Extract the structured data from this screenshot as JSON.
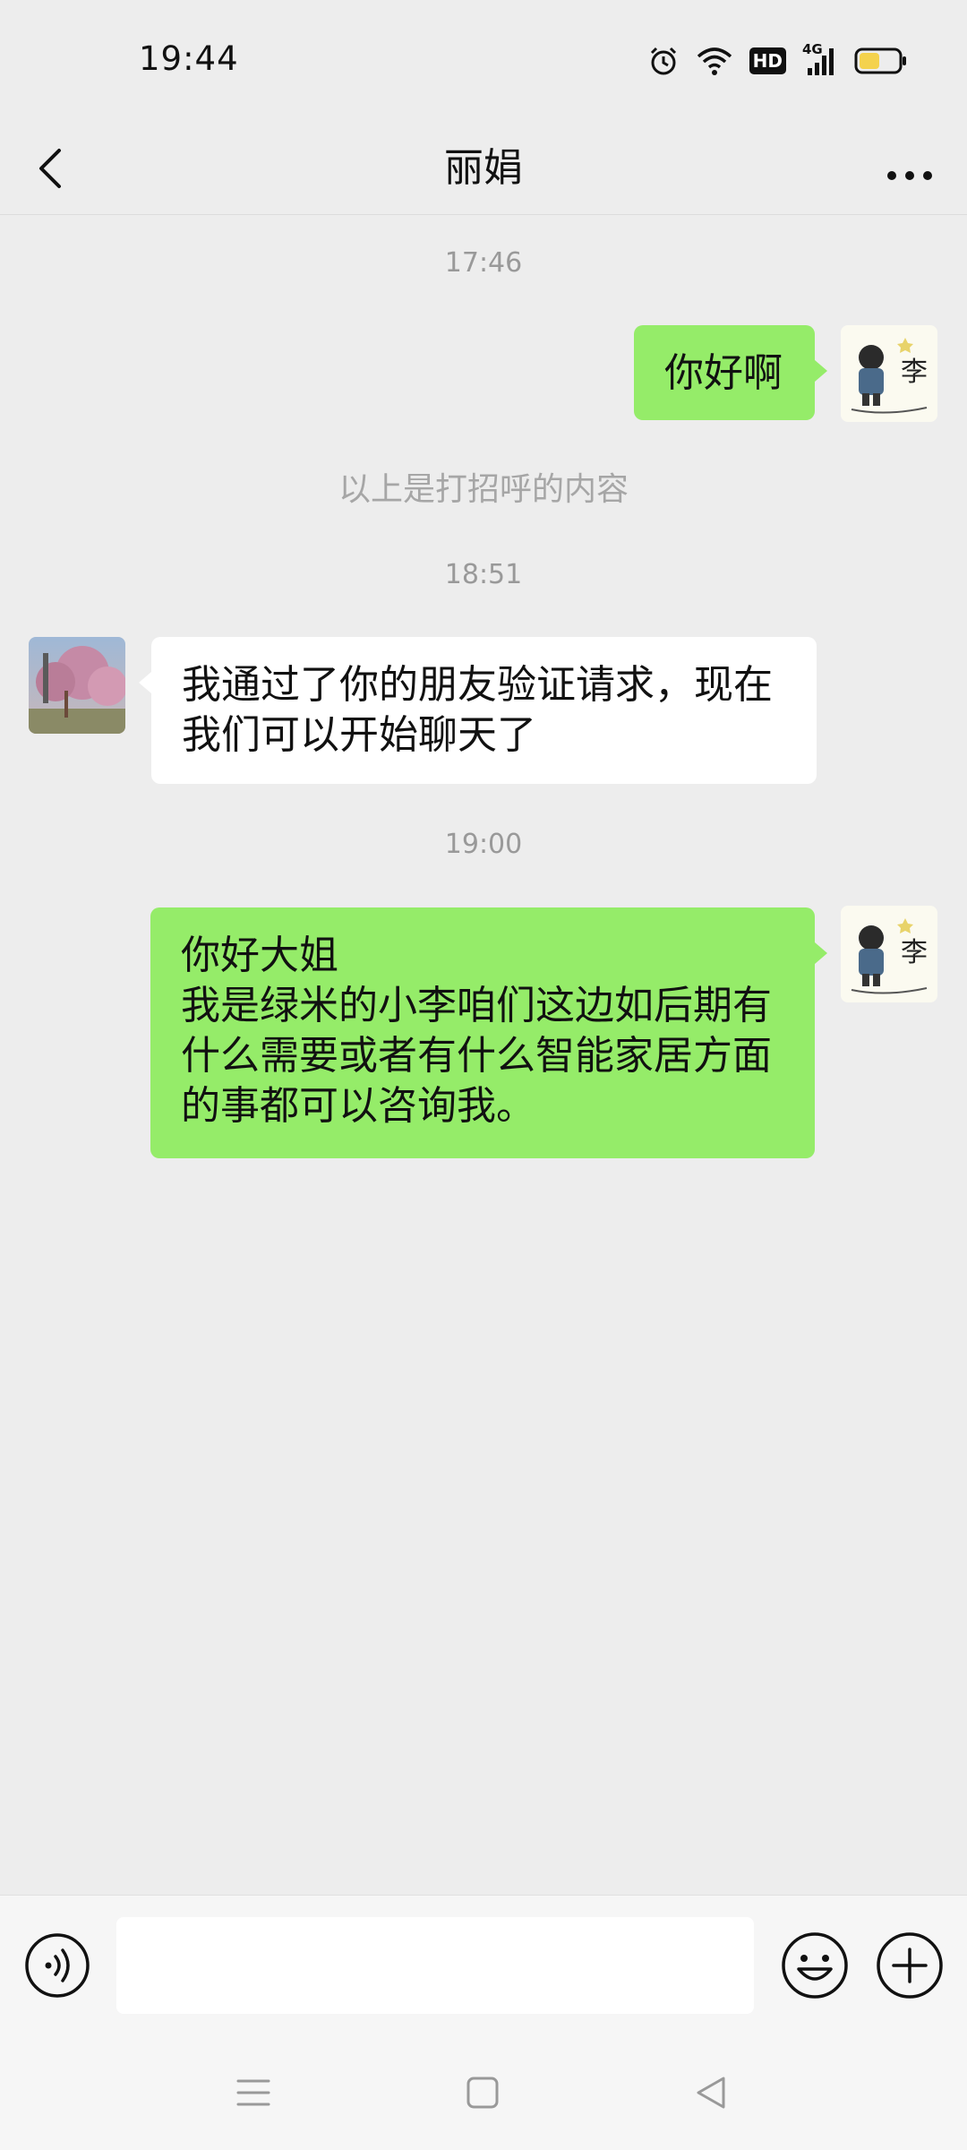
{
  "status_bar": {
    "time": "19:44",
    "icons": [
      "alarm-icon",
      "wifi-icon",
      "hd-icon",
      "signal-4g-icon",
      "battery-icon"
    ],
    "hd_label": "HD",
    "network_label": "4G"
  },
  "header": {
    "title": "丽娟",
    "back_icon": "chevron-left-icon",
    "more_icon": "more-dots-icon"
  },
  "chat": {
    "timestamps": [
      "17:46",
      "18:51",
      "19:00"
    ],
    "system_note": "以上是打招呼的内容",
    "messages": [
      {
        "direction": "out",
        "lines": [
          "你好啊"
        ]
      },
      {
        "direction": "in",
        "lines": [
          "我通过了你的朋友验证请求，现在",
          "我们可以开始聊天了"
        ]
      },
      {
        "direction": "out",
        "lines": [
          "你好大姐",
          "我是绿米的小李咱们这边如后期有",
          "什么需要或者有什么智能家居方面",
          "的事都可以咨询我。"
        ]
      }
    ],
    "my_avatar_char": "李"
  },
  "input_bar": {
    "value": "",
    "placeholder": ""
  },
  "colors": {
    "background": "#ededed",
    "bubble_out": "#95ec69",
    "bubble_in": "#ffffff",
    "timestamp": "#999999"
  }
}
